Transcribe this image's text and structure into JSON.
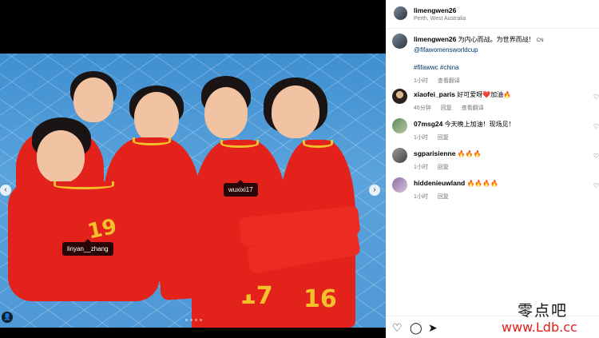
{
  "post": {
    "username": "limengwen26",
    "location": "Perth, West Australia"
  },
  "caption": {
    "username": "limengwen26",
    "text": "为内心而战。为世界而战！",
    "flag": "CN",
    "mention": "@fifawomensworldcup",
    "hashtags": "#fifawwc #china",
    "time": "1小时",
    "translate": "查看翻译"
  },
  "comments": [
    {
      "username": "xiaofei_paris",
      "text": "好可爱呀❤️加油🔥",
      "time": "46分钟",
      "reply": "回复",
      "translate": "查看翻译"
    },
    {
      "username": "07msg24",
      "text": "今天晚上加油！现场见！",
      "time": "1小时",
      "reply": "回复"
    },
    {
      "username": "sgparisienne",
      "text": "🔥🔥🔥",
      "time": "1小时",
      "reply": "回复"
    },
    {
      "username": "hiddenieuwland",
      "text": "🔥🔥🔥🔥",
      "time": "1小时",
      "reply": "回复"
    }
  ],
  "photo_tags": {
    "tag1": "wuxixi17",
    "tag2": "linyan__zhang"
  },
  "jersey_numbers": [
    "19",
    "17",
    "16"
  ],
  "icons": {
    "like": "heart-icon",
    "comment": "comment-icon",
    "share": "send-icon",
    "more": "more-icon"
  },
  "watermark": {
    "cn": "零点吧",
    "url": "www.Ldb.cc"
  },
  "colors": {
    "jersey_red": "#e3221c",
    "jersey_gold": "#f5c12a",
    "link_blue": "#00376b",
    "background_blue": "#4f98d6"
  }
}
